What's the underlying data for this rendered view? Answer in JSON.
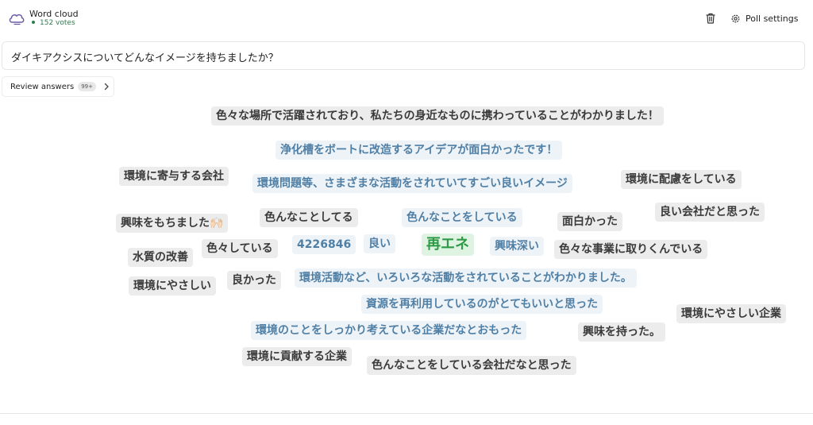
{
  "header": {
    "title": "Word cloud",
    "votes": "152 votes",
    "settings_label": "Poll settings",
    "icons": [
      "word-cloud-icon",
      "trash-icon",
      "gear-icon"
    ]
  },
  "question": "ダイキアクシスについてどんなイメージを持ちましたか？",
  "review": {
    "label": "Review answers",
    "badge": "99+"
  },
  "colors": {
    "default": "#3a3a3a",
    "blue": "#4f7fa5",
    "green": "#2f9a45",
    "votes": "#2e7d4f"
  },
  "words": [
    "色々な場所で活躍されており、私たちの身近なものに携わっていることがわかりました！",
    "浄化槽をボートに改造するアイデアが面白かったです！",
    "環境に寄与する会社",
    "環境問題等、さまざまな活動をされていてすごい良いイメージ",
    "環境に配慮をしている",
    "興味をもちました🙌🏻",
    "色んなことしてる",
    "色んなことをしている",
    "面白かった",
    "良い会社だと思った",
    "色々している",
    "4226846",
    "良い",
    "再エネ",
    "興味深い",
    "色々な事業に取りくんでいる",
    "水質の改善",
    "環境にやさしい",
    "良かった",
    "環境活動など、いろいろな活動をされていることがわかりました。",
    "資源を再利用しているのがとてもいいと思った",
    "環境にやさしい企業",
    "環境のことをしっかり考えている企業だなとおもった",
    "興味を持った。",
    "環境に貢献する企業",
    "色んなことをしている会社だなと思った"
  ]
}
